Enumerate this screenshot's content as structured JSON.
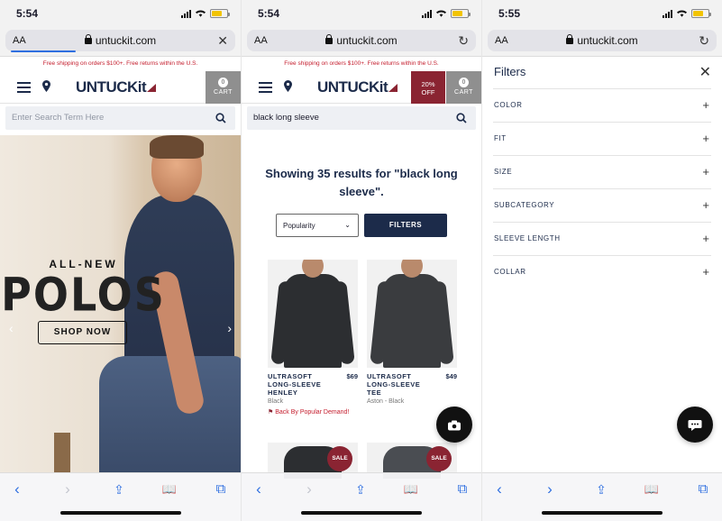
{
  "colors": {
    "accent": "#2f6fe0",
    "brand_navy": "#1c2b4a",
    "brand_red": "#8a2432",
    "promo_red": "#c41c2c"
  },
  "panels": [
    {
      "status": {
        "time": "5:54",
        "icons": [
          "location-arrow-icon",
          "signal-icon",
          "wifi-icon",
          "battery-icon"
        ]
      },
      "address": {
        "aa": "AA",
        "url": "untuckit.com",
        "right_icon": "close-icon",
        "right_glyph": "✕"
      }
    },
    {
      "status": {
        "time": "5:54",
        "icons": [
          "location-arrow-icon",
          "signal-icon",
          "wifi-icon",
          "battery-icon"
        ]
      },
      "address": {
        "aa": "AA",
        "url": "untuckit.com",
        "right_icon": "reload-icon",
        "right_glyph": "↻"
      }
    },
    {
      "status": {
        "time": "5:55",
        "icons": [
          "location-arrow-icon",
          "signal-icon",
          "wifi-icon",
          "battery-icon"
        ]
      },
      "address": {
        "aa": "AA",
        "url": "untuckit.com",
        "right_icon": "reload-icon",
        "right_glyph": "↻"
      }
    }
  ],
  "site": {
    "promo": "Free shipping on orders $100+. Free returns within the U.S.",
    "logo": "UNTUCKit",
    "cart": {
      "count": "0",
      "label": "CART"
    },
    "promo_badge": {
      "line1": "20%",
      "line2": "OFF"
    },
    "search_placeholder": "Enter Search Term Here",
    "search_value": "black long sleeve"
  },
  "hero": {
    "eyebrow": "ALL-NEW",
    "headline": "POLOS",
    "cta": "SHOP NOW",
    "prev": "‹",
    "next": "›"
  },
  "results": {
    "title": "Showing 35 results for \"black long sleeve\".",
    "sort_value": "Popularity",
    "filters_button": "FILTERS",
    "products": [
      {
        "name": "ULTRASOFT LONG-SLEEVE HENLEY",
        "price": "$69",
        "color": "Black",
        "tag": "Back By Popular Demand!"
      },
      {
        "name": "ULTRASOFT LONG-SLEEVE TEE",
        "price": "$49",
        "color": "Aston - Black",
        "tag": ""
      }
    ],
    "sale_badge": "SALE"
  },
  "filters": {
    "title": "Filters",
    "rows": [
      "COLOR",
      "FIT",
      "SIZE",
      "SUBCATEGORY",
      "SLEEVE LENGTH",
      "COLLAR"
    ]
  },
  "toolbar": {
    "back": "‹",
    "forward": "›",
    "share": "⇪",
    "bookmarks": "📖",
    "tabs": "⧉"
  }
}
